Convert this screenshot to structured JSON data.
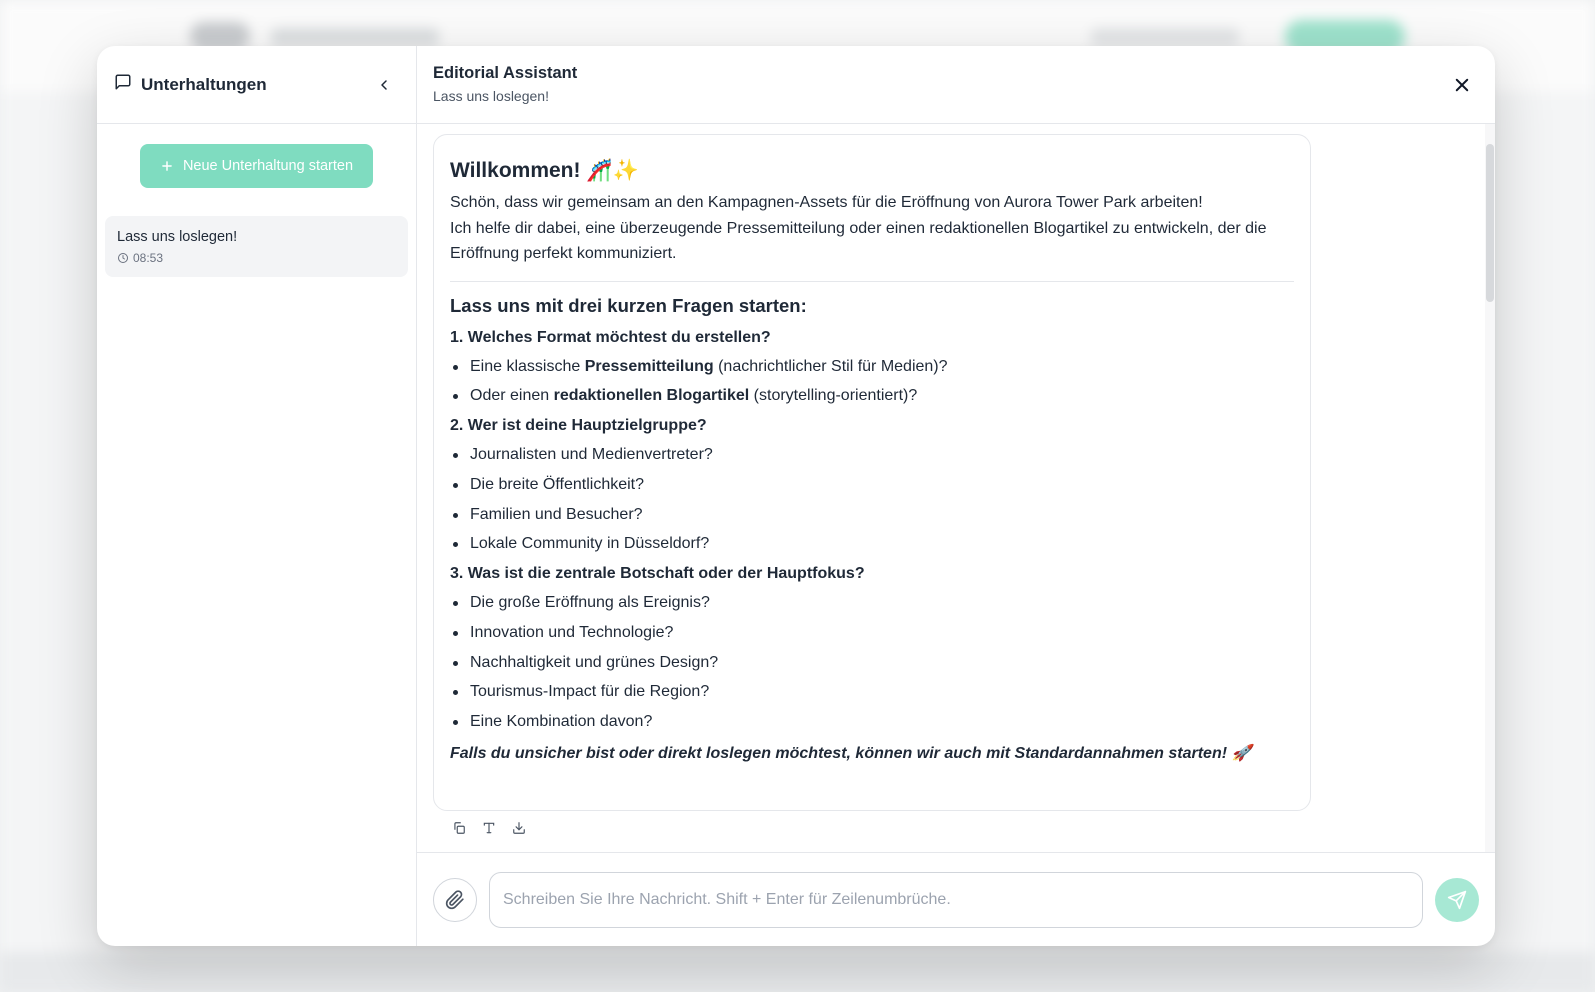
{
  "sidebar": {
    "title": "Unterhaltungen",
    "new_chat_label": "Neue Unterhaltung starten",
    "conversations": [
      {
        "title": "Lass uns loslegen!",
        "time": "08:53"
      }
    ]
  },
  "header": {
    "assistant_name": "Editorial Assistant",
    "subtitle": "Lass uns loslegen!"
  },
  "message": {
    "welcome_text": "Willkommen!",
    "welcome_emoji": "🎢✨",
    "intro_line1": "Schön, dass wir gemeinsam an den Kampagnen-Assets für die Eröffnung von Aurora Tower Park arbeiten!",
    "intro_line2": "Ich helfe dir dabei, eine überzeugende Pressemitteilung oder einen redaktionellen Blogartikel zu entwickeln, der die Eröffnung perfekt kommuniziert.",
    "questions_heading": "Lass uns mit drei kurzen Fragen starten:",
    "q1": {
      "title": "1. Welches Format möchtest du erstellen?",
      "opt1_pre": "Eine klassische ",
      "opt1_bold": "Pressemitteilung",
      "opt1_post": " (nachrichtlicher Stil für Medien)?",
      "opt2_pre": "Oder einen ",
      "opt2_bold": "redaktionellen Blogartikel",
      "opt2_post": " (storytelling-orientiert)?"
    },
    "q2": {
      "title": "2. Wer ist deine Hauptzielgruppe?",
      "options": [
        "Journalisten und Medienvertreter?",
        "Die breite Öffentlichkeit?",
        "Familien und Besucher?",
        "Lokale Community in Düsseldorf?"
      ]
    },
    "q3": {
      "title": "3. Was ist die zentrale Botschaft oder der Hauptfokus?",
      "options": [
        "Die große Eröffnung als Ereignis?",
        "Innovation und Technologie?",
        "Nachhaltigkeit und grünes Design?",
        "Tourismus-Impact für die Region?",
        "Eine Kombination davon?"
      ]
    },
    "outro": "Falls du unsicher bist oder direkt loslegen möchtest, können wir auch mit Standardannahmen starten! 🚀"
  },
  "composer": {
    "placeholder": "Schreiben Sie Ihre Nachricht. Shift + Enter für Zeilenumbrüche."
  },
  "icons": {
    "sidebar_title": "chat-bubble-icon",
    "collapse": "chevron-left-icon",
    "new_chat": "plus-icon",
    "time": "clock-icon",
    "close": "close-icon",
    "copy": "copy-icon",
    "text": "text-icon",
    "download": "download-icon",
    "attach": "paperclip-icon",
    "send": "send-icon"
  },
  "colors": {
    "accent": "#7fdcc0",
    "send_button": "#a7e8d4",
    "text": "#1f2937",
    "muted": "#6b7280",
    "border": "#e5e7eb"
  }
}
